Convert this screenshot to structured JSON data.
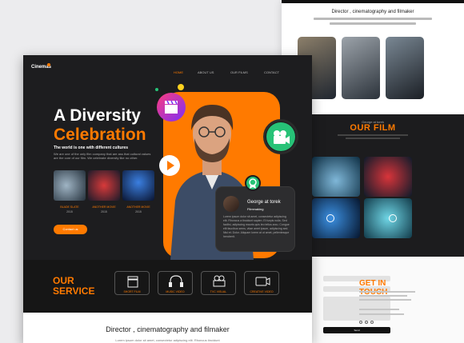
{
  "back_page": {
    "heading": "Director , cinematography and filmaker",
    "film_section": {
      "tag": "George at torek",
      "title": "OUR FILM"
    },
    "contact": {
      "title": "GET IN TOUCH",
      "send_label": "Send"
    }
  },
  "main_page": {
    "logo": "Cinemas",
    "nav": [
      "HOME",
      "ABOUT US",
      "OUR FILMS",
      "CONTACT"
    ],
    "hero": {
      "line1": "A Diversity",
      "line2": "Celebration",
      "tagline": "The world is one with different cultures",
      "body": "We are one of the only film company that are ass that cultural values are the core of our film. We celebrate diversity like no other."
    },
    "movies": [
      {
        "title": "BLADE SLATE",
        "year": "2015"
      },
      {
        "title": "ANOTHER MOVIE",
        "year": "2015"
      },
      {
        "title": "ANOTHER MOVIE",
        "year": "2015"
      }
    ],
    "contact_button": "Contact us",
    "profile_card": {
      "name": "George at torek",
      "role": "Filmmaking",
      "bio": "Lorem ipsum dolor sit amet, consectetur adipiscing elit. Rhoncus a tincidunt sapien. Et turpis nulla. Sed facilisi, adipiscing mauris quis leo tellus arcu. Congue elit faucibus sems, vitae amet ipsum, adipiscing sed. Nisi et. Dolor. Aliquam lorem at ut amet, pellentesque hendrerit."
    },
    "service": {
      "title_line1": "OUR",
      "title_line2": "SERVICE",
      "items": [
        {
          "label": "SHORT FILM",
          "icon": "clapperboard-icon"
        },
        {
          "label": "MUSIC VIDEO",
          "icon": "headphones-icon"
        },
        {
          "label": "TVC VISUAL",
          "icon": "tv-camera-icon"
        },
        {
          "label": "CREATIVE VIDEO",
          "icon": "video-icon"
        }
      ]
    },
    "footer": {
      "heading": "Director , cinematography and filmaker",
      "sub": "Lorem ipsum dolor sit amet, consectetur adipiscing elit. Rhoncus tincidunt"
    }
  },
  "colors": {
    "accent": "#ff7a00",
    "dark": "#1d1d1f",
    "green": "#27c277"
  }
}
